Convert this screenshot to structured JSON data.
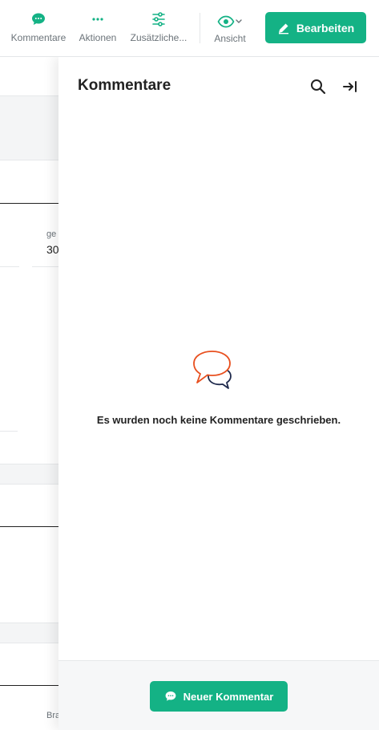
{
  "toolbar": {
    "comments_label": "Kommentare",
    "actions_label": "Aktionen",
    "extra_label": "Zusätzliche...",
    "view_label": "Ansicht",
    "edit_label": "Bearbeiten"
  },
  "background": {
    "field_label_partial": "ge",
    "field_value_partial": "30",
    "footer_label_partial": "Bra"
  },
  "panel": {
    "title": "Kommentare",
    "empty_message": "Es wurden noch keine Kommentare geschrieben.",
    "new_comment_label": "Neuer Kommentar"
  },
  "colors": {
    "accent": "#14b285",
    "bubble_orange": "#e8501f",
    "bubble_navy": "#1f2a4d"
  }
}
